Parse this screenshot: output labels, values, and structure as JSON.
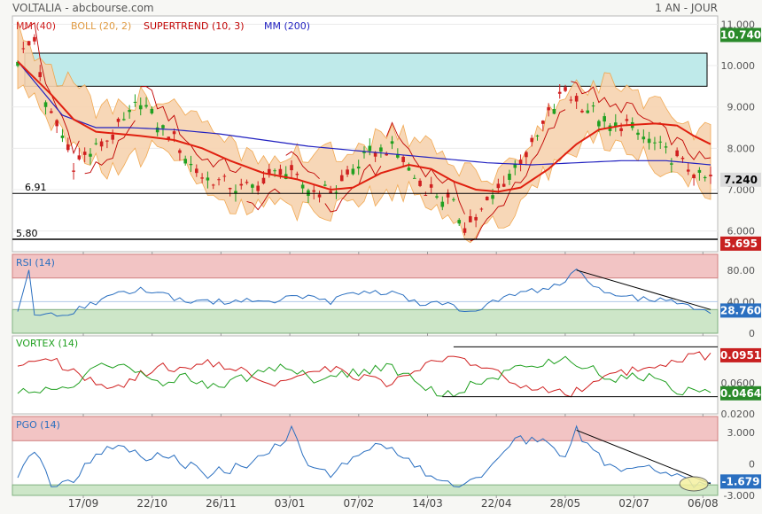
{
  "header": {
    "title": "VOLTALIA - abcbourse.com",
    "period": "1 AN - JOUR"
  },
  "x_ticks": [
    "17/09",
    "22/10",
    "26/11",
    "03/01",
    "07/02",
    "14/03",
    "22/04",
    "28/05",
    "02/07",
    "06/08"
  ],
  "colors": {
    "mm40": "#e02010",
    "boll": "#f0a040",
    "boll_fill": "#f7d3b0",
    "supertrend": "#c00000",
    "mm200": "#2020c0",
    "up": "#20a020",
    "down": "#d02020",
    "zone": "#bfeaea",
    "rsi": "#2a6fc0",
    "vortex_plus": "#20a020",
    "vortex_minus": "#d02020",
    "pgo": "#2a6fc0",
    "over": "#f2c4c4",
    "under": "#cde6c8"
  },
  "chart_data": [
    {
      "type": "candlestick",
      "legend": [
        "MM (40)",
        "BOLL (20, 2)",
        "SUPERTREND (10, 3)",
        "MM (200)"
      ],
      "ylim": [
        5.5,
        11.2
      ],
      "y_ticks": [
        "11.000",
        "10.000",
        "9.000",
        "8.000",
        "7.000",
        "6.000"
      ],
      "y_tick_values": [
        11,
        10,
        9,
        8,
        7,
        6
      ],
      "last_price": "7.240",
      "last_price_value": 7.24,
      "high_label": "10.740",
      "high_value": 10.74,
      "low_label": "5.695",
      "low_value": 5.695,
      "support_levels": [
        {
          "label": "6.91",
          "value": 6.91
        },
        {
          "label": "5.80",
          "value": 5.8
        }
      ],
      "resistance_zone": [
        9.5,
        10.3
      ],
      "close_path": [
        [
          0,
          10.2
        ],
        [
          3,
          10.6
        ],
        [
          5,
          9.0
        ],
        [
          8,
          8.3
        ],
        [
          10,
          7.6
        ],
        [
          14,
          8.0
        ],
        [
          17,
          8.3
        ],
        [
          20,
          8.8
        ],
        [
          22,
          9.2
        ],
        [
          25,
          8.6
        ],
        [
          28,
          8.2
        ],
        [
          31,
          7.6
        ],
        [
          33,
          7.3
        ],
        [
          36,
          7.2
        ],
        [
          40,
          7.0
        ],
        [
          44,
          7.15
        ],
        [
          47,
          7.5
        ],
        [
          49,
          7.3
        ],
        [
          53,
          6.95
        ],
        [
          57,
          7.0
        ],
        [
          60,
          7.5
        ],
        [
          63,
          7.9
        ],
        [
          67,
          8.0
        ],
        [
          69,
          7.7
        ],
        [
          72,
          7.1
        ],
        [
          75,
          6.9
        ],
        [
          78,
          6.6
        ],
        [
          80,
          6.1
        ],
        [
          82,
          6.3
        ],
        [
          86,
          7.0
        ],
        [
          89,
          7.6
        ],
        [
          92,
          8.0
        ],
        [
          95,
          8.8
        ],
        [
          98,
          9.4
        ],
        [
          100,
          9.1
        ],
        [
          103,
          8.9
        ],
        [
          106,
          8.5
        ],
        [
          109,
          8.6
        ],
        [
          111,
          8.35
        ],
        [
          114,
          8.1
        ],
        [
          117,
          7.8
        ],
        [
          120,
          7.5
        ],
        [
          122,
          7.3
        ],
        [
          124,
          7.24
        ]
      ],
      "mm40_path": [
        [
          0,
          10.1
        ],
        [
          6,
          9.3
        ],
        [
          10,
          8.7
        ],
        [
          14,
          8.4
        ],
        [
          18,
          8.35
        ],
        [
          22,
          8.3
        ],
        [
          28,
          8.2
        ],
        [
          33,
          8.0
        ],
        [
          38,
          7.7
        ],
        [
          44,
          7.4
        ],
        [
          50,
          7.25
        ],
        [
          56,
          7.0
        ],
        [
          60,
          7.05
        ],
        [
          65,
          7.4
        ],
        [
          70,
          7.6
        ],
        [
          74,
          7.5
        ],
        [
          78,
          7.2
        ],
        [
          82,
          7.0
        ],
        [
          86,
          6.95
        ],
        [
          90,
          7.05
        ],
        [
          95,
          7.5
        ],
        [
          100,
          8.1
        ],
        [
          104,
          8.45
        ],
        [
          108,
          8.55
        ],
        [
          114,
          8.6
        ],
        [
          118,
          8.55
        ],
        [
          121,
          8.3
        ],
        [
          124,
          8.1
        ]
      ],
      "mm200_path": [
        [
          0,
          10.1
        ],
        [
          8,
          8.8
        ],
        [
          14,
          8.5
        ],
        [
          20,
          8.5
        ],
        [
          28,
          8.45
        ],
        [
          36,
          8.35
        ],
        [
          44,
          8.2
        ],
        [
          52,
          8.05
        ],
        [
          60,
          7.95
        ],
        [
          68,
          7.85
        ],
        [
          76,
          7.75
        ],
        [
          84,
          7.65
        ],
        [
          92,
          7.6
        ],
        [
          100,
          7.65
        ],
        [
          108,
          7.7
        ],
        [
          116,
          7.7
        ],
        [
          124,
          7.6
        ]
      ],
      "bollinger": {
        "upper_offset": 0.75,
        "lower_offset": 0.75
      },
      "n_candles": 125
    },
    {
      "type": "line",
      "title": "RSI (14)",
      "ylim": [
        0,
        100
      ],
      "y_ticks": [
        "80.00",
        "40.00",
        "0"
      ],
      "y_tick_values": [
        80,
        40,
        0
      ],
      "overbought": 70,
      "oversold": 30,
      "last_value": "28.760",
      "path": [
        [
          0,
          30
        ],
        [
          2,
          78
        ],
        [
          3,
          25
        ],
        [
          6,
          22
        ],
        [
          10,
          28
        ],
        [
          14,
          38
        ],
        [
          18,
          50
        ],
        [
          22,
          55
        ],
        [
          26,
          52
        ],
        [
          28,
          45
        ],
        [
          32,
          38
        ],
        [
          36,
          40
        ],
        [
          40,
          42
        ],
        [
          44,
          38
        ],
        [
          48,
          44
        ],
        [
          52,
          46
        ],
        [
          56,
          40
        ],
        [
          60,
          50
        ],
        [
          64,
          52
        ],
        [
          68,
          50
        ],
        [
          70,
          40
        ],
        [
          74,
          38
        ],
        [
          78,
          34
        ],
        [
          80,
          26
        ],
        [
          82,
          30
        ],
        [
          86,
          44
        ],
        [
          90,
          52
        ],
        [
          94,
          56
        ],
        [
          98,
          64
        ],
        [
          100,
          80
        ],
        [
          103,
          60
        ],
        [
          106,
          50
        ],
        [
          110,
          45
        ],
        [
          114,
          42
        ],
        [
          118,
          38
        ],
        [
          122,
          30
        ],
        [
          124,
          28.76
        ]
      ]
    },
    {
      "type": "line",
      "title": "VORTEX (14)",
      "ylim": [
        0.02,
        0.12
      ],
      "y_ticks": [
        "0.0600",
        "0.0200"
      ],
      "y_tick_values": [
        0.06,
        0.02
      ],
      "last_plus": "0.0464",
      "last_minus": "0.0951",
      "plus_path": [
        [
          0,
          0.05
        ],
        [
          6,
          0.05
        ],
        [
          10,
          0.06
        ],
        [
          14,
          0.08
        ],
        [
          18,
          0.085
        ],
        [
          22,
          0.07
        ],
        [
          26,
          0.06
        ],
        [
          30,
          0.07
        ],
        [
          34,
          0.055
        ],
        [
          38,
          0.06
        ],
        [
          42,
          0.07
        ],
        [
          46,
          0.08
        ],
        [
          50,
          0.075
        ],
        [
          54,
          0.06
        ],
        [
          58,
          0.07
        ],
        [
          62,
          0.075
        ],
        [
          66,
          0.08
        ],
        [
          70,
          0.07
        ],
        [
          74,
          0.05
        ],
        [
          78,
          0.045
        ],
        [
          82,
          0.06
        ],
        [
          86,
          0.07
        ],
        [
          90,
          0.08
        ],
        [
          94,
          0.085
        ],
        [
          98,
          0.09
        ],
        [
          102,
          0.08
        ],
        [
          106,
          0.065
        ],
        [
          110,
          0.07
        ],
        [
          114,
          0.065
        ],
        [
          118,
          0.05
        ],
        [
          122,
          0.048
        ],
        [
          124,
          0.0464
        ]
      ],
      "minus_path": [
        [
          0,
          0.085
        ],
        [
          6,
          0.09
        ],
        [
          10,
          0.075
        ],
        [
          14,
          0.06
        ],
        [
          18,
          0.055
        ],
        [
          22,
          0.07
        ],
        [
          26,
          0.08
        ],
        [
          30,
          0.075
        ],
        [
          34,
          0.085
        ],
        [
          38,
          0.08
        ],
        [
          42,
          0.07
        ],
        [
          46,
          0.06
        ],
        [
          50,
          0.065
        ],
        [
          54,
          0.08
        ],
        [
          58,
          0.075
        ],
        [
          62,
          0.065
        ],
        [
          66,
          0.06
        ],
        [
          70,
          0.07
        ],
        [
          74,
          0.09
        ],
        [
          78,
          0.095
        ],
        [
          82,
          0.08
        ],
        [
          86,
          0.07
        ],
        [
          90,
          0.055
        ],
        [
          94,
          0.05
        ],
        [
          98,
          0.045
        ],
        [
          102,
          0.055
        ],
        [
          106,
          0.07
        ],
        [
          110,
          0.075
        ],
        [
          114,
          0.08
        ],
        [
          118,
          0.09
        ],
        [
          122,
          0.095
        ],
        [
          124,
          0.0951
        ]
      ]
    },
    {
      "type": "line",
      "title": "PGO (14)",
      "ylim": [
        -3,
        4.5
      ],
      "y_ticks": [
        "3.000",
        "0",
        "-3.000"
      ],
      "y_tick_values": [
        3,
        0,
        -3
      ],
      "upper_band": 2.2,
      "lower_band": -2,
      "last_value": "-1.679",
      "path": [
        [
          0,
          -1
        ],
        [
          3,
          1.2
        ],
        [
          6,
          -2.2
        ],
        [
          10,
          -1.5
        ],
        [
          14,
          1
        ],
        [
          18,
          2
        ],
        [
          22,
          0.5
        ],
        [
          26,
          1
        ],
        [
          30,
          0
        ],
        [
          34,
          -1
        ],
        [
          38,
          -0.5
        ],
        [
          42,
          0
        ],
        [
          46,
          1.5
        ],
        [
          49,
          3.2
        ],
        [
          52,
          -0.5
        ],
        [
          56,
          -1
        ],
        [
          60,
          0.5
        ],
        [
          64,
          1.5
        ],
        [
          68,
          1
        ],
        [
          72,
          -0.5
        ],
        [
          76,
          -1.5
        ],
        [
          79,
          -2.5
        ],
        [
          82,
          -1.5
        ],
        [
          86,
          0.5
        ],
        [
          90,
          2.5
        ],
        [
          94,
          2
        ],
        [
          98,
          1
        ],
        [
          100,
          3.2
        ],
        [
          103,
          1
        ],
        [
          106,
          0
        ],
        [
          110,
          -0.5
        ],
        [
          114,
          -0.5
        ],
        [
          118,
          -1.2
        ],
        [
          121,
          -2.2
        ],
        [
          124,
          -1.679
        ]
      ]
    }
  ]
}
